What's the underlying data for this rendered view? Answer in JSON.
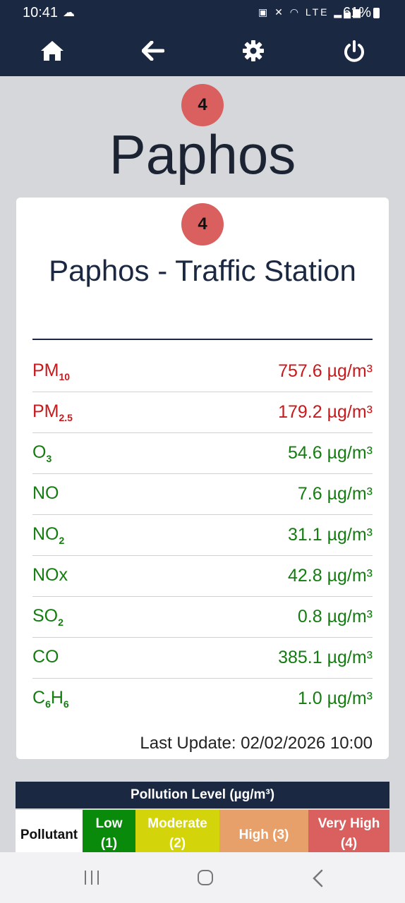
{
  "status_bar": {
    "time": "10:41",
    "weather_icon": "cloud-sun-icon",
    "icons_text": "◘ ✕ ◜ ᵛᵒ ▐",
    "battery": "61%"
  },
  "nav": {
    "home_icon": "home-icon",
    "back_icon": "arrow-left-icon",
    "settings_icon": "gear-icon",
    "power_icon": "power-icon"
  },
  "city": {
    "aqi_level": "4",
    "name": "Paphos"
  },
  "station": {
    "aqi_level": "4",
    "name": "Paphos - Traffic Station",
    "last_update": "Last Update: 02/02/2026 10:00",
    "readings": [
      {
        "base": "PM",
        "sub": "10",
        "value": "757.6 µg/m³",
        "status": "bad"
      },
      {
        "base": "PM",
        "sub": "2.5",
        "value": "179.2 µg/m³",
        "status": "bad"
      },
      {
        "base": "O",
        "sub": "3",
        "value": "54.6 µg/m³",
        "status": "good"
      },
      {
        "base": "NO",
        "sub": "",
        "value": "7.6 µg/m³",
        "status": "good"
      },
      {
        "base": "NO",
        "sub": "2",
        "value": "31.1 µg/m³",
        "status": "good"
      },
      {
        "base": "NOx",
        "sub": "",
        "value": "42.8 µg/m³",
        "status": "good"
      },
      {
        "base": "SO",
        "sub": "2",
        "value": "0.8 µg/m³",
        "status": "good"
      },
      {
        "base": "CO",
        "sub": "",
        "value": "385.1 µg/m³",
        "status": "good"
      },
      {
        "base": "C",
        "sub": "6",
        "base2": "H",
        "sub2": "6",
        "value": "1.0 µg/m³",
        "status": "good"
      }
    ]
  },
  "legend": {
    "title": "Pollution Level (µg/m³)",
    "pollutant_header": "Pollutant",
    "levels": [
      {
        "label": "Low",
        "num": "(1)",
        "color": "#0a8a0a"
      },
      {
        "label": "Moderate",
        "num": "(2)",
        "color": "#d4d40a"
      },
      {
        "label": "High (3)",
        "num": "",
        "color": "#e8a06a"
      },
      {
        "label": "Very High",
        "num": "(4)",
        "color": "#d9605e"
      }
    ]
  },
  "colors": {
    "header": "#1b2841",
    "badge": "#d9605e",
    "bad": "#c8191c",
    "good": "#137d10"
  }
}
